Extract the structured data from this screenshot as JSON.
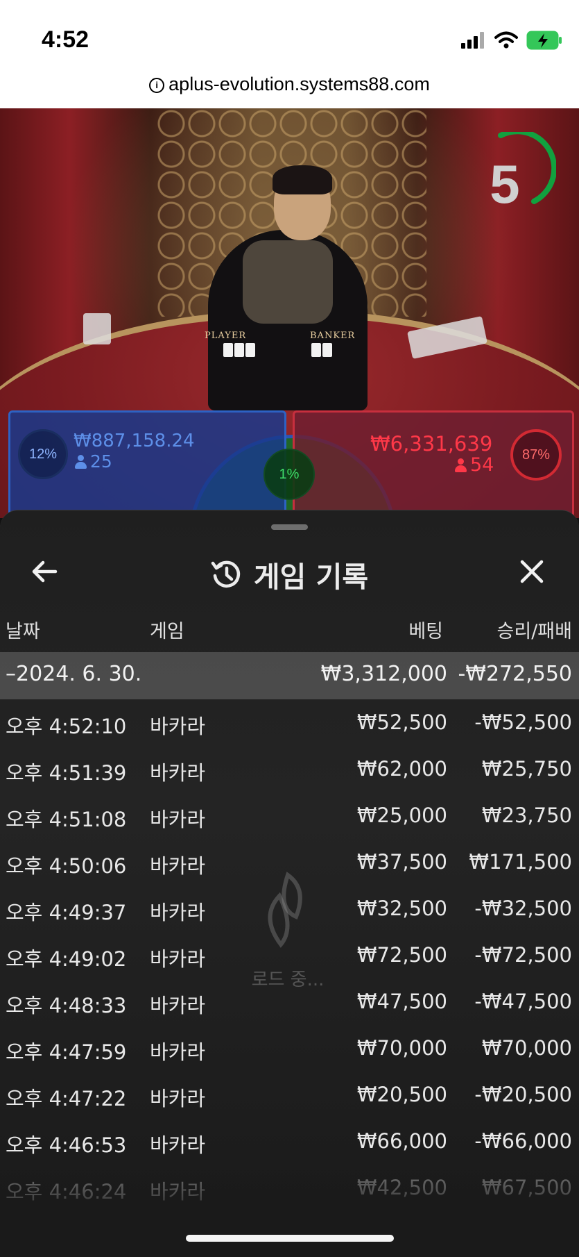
{
  "status_bar": {
    "time": "4:52"
  },
  "browser": {
    "url": "aplus-evolution.systems88.com"
  },
  "live_game": {
    "countdown": "5",
    "player": {
      "percent": "12%",
      "amount": "₩887,158.24",
      "count": "25"
    },
    "banker": {
      "percent": "87%",
      "amount": "₩6,331,639",
      "count": "54"
    },
    "tie": {
      "percent": "1%"
    },
    "table_labels": {
      "player": "PLAYER",
      "banker": "BANKER"
    }
  },
  "history": {
    "title": "게임 기록",
    "columns": {
      "date": "날짜",
      "game": "게임",
      "bet": "베팅",
      "result": "승리/패배"
    },
    "date_group": {
      "date": "–2024. 6. 30.",
      "bet_total": "₩3,312,000",
      "result_total": "-₩272,550"
    },
    "rows": [
      {
        "time": "오후 4:52:10",
        "game": "바카라",
        "bet": "₩52,500",
        "result": "-₩52,500"
      },
      {
        "time": "오후 4:51:39",
        "game": "바카라",
        "bet": "₩62,000",
        "result": "₩25,750"
      },
      {
        "time": "오후 4:51:08",
        "game": "바카라",
        "bet": "₩25,000",
        "result": "₩23,750"
      },
      {
        "time": "오후 4:50:06",
        "game": "바카라",
        "bet": "₩37,500",
        "result": "₩171,500"
      },
      {
        "time": "오후 4:49:37",
        "game": "바카라",
        "bet": "₩32,500",
        "result": "-₩32,500"
      },
      {
        "time": "오후 4:49:02",
        "game": "바카라",
        "bet": "₩72,500",
        "result": "-₩72,500"
      },
      {
        "time": "오후 4:48:33",
        "game": "바카라",
        "bet": "₩47,500",
        "result": "-₩47,500"
      },
      {
        "time": "오후 4:47:59",
        "game": "바카라",
        "bet": "₩70,000",
        "result": "₩70,000"
      },
      {
        "time": "오후 4:47:22",
        "game": "바카라",
        "bet": "₩20,500",
        "result": "-₩20,500"
      },
      {
        "time": "오후 4:46:53",
        "game": "바카라",
        "bet": "₩66,000",
        "result": "-₩66,000"
      },
      {
        "time": "오후 4:46:24",
        "game": "바카라",
        "bet": "₩42,500",
        "result": "₩67,500"
      }
    ],
    "loading_text": "로드 중..."
  },
  "colors": {
    "player_blue": "#2d62c4",
    "banker_red": "#c72f3e",
    "tie_green": "#1f8a3a",
    "battery_green": "#34c759"
  },
  "icons": [
    "info-icon",
    "signal-icon",
    "wifi-icon",
    "battery-charging-icon",
    "back-arrow-icon",
    "history-icon",
    "close-icon",
    "loading-spinner-icon",
    "person-icon"
  ]
}
